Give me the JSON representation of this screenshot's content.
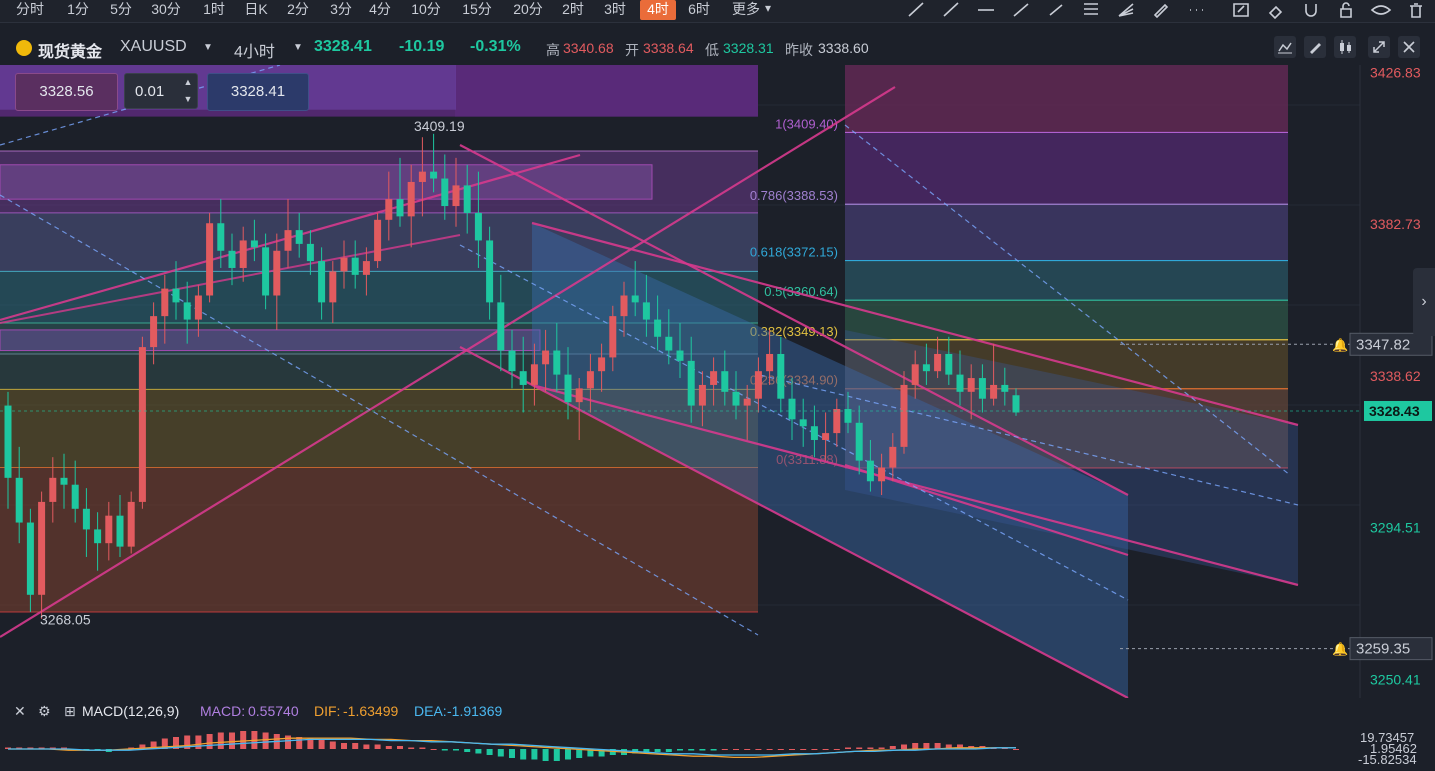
{
  "timeframes": {
    "items": [
      "分时",
      "1分",
      "5分",
      "30分",
      "1时",
      "日K",
      "2分",
      "3分",
      "4分",
      "10分",
      "15分",
      "20分",
      "2时",
      "3时",
      "4时",
      "6时",
      "更多"
    ],
    "active": "4时"
  },
  "toolbar_icons": [
    "trend-line-icon",
    "ray-line-icon",
    "horizontal-line-icon",
    "extended-line-icon",
    "segment-icon",
    "fibonacci-icon",
    "gann-fan-icon",
    "brush-icon",
    "more-icon",
    "edit-icon",
    "eraser-icon",
    "magnet-icon",
    "lock-icon",
    "visibility-icon",
    "trash-icon"
  ],
  "symbol": {
    "name": "现货黄金",
    "code": "XAUUSD",
    "interval": "4小时",
    "price": "3328.41",
    "change": "-10.19",
    "change_pct": "-0.31%",
    "high_label": "高",
    "high": "3340.68",
    "open_label": "开",
    "open": "3338.64",
    "low_label": "低",
    "low": "3328.31",
    "prev_label": "昨收",
    "prev": "3338.60"
  },
  "order_inputs": {
    "sell": "3328.56",
    "lot": "0.01",
    "buy": "3328.41"
  },
  "colors": {
    "up": "#e25b5f",
    "down": "#1ec8a0",
    "accent": "#ea6c3a",
    "line": "#d63a8d",
    "background": "#1c2029"
  },
  "chart_data": {
    "type": "candlestick",
    "symbol": "XAUUSD",
    "interval": "4小时",
    "price_axis": {
      "ticks": [
        3426.83,
        3382.73,
        3338.62,
        3294.51,
        3250.41
      ],
      "ylim": [
        3245.0,
        3429.0
      ],
      "current_price": "3328.43",
      "alert_levels": [
        "3347.82",
        "3259.35"
      ]
    },
    "annotations": {
      "swing_high": "3409.19",
      "swing_low": "3268.05"
    },
    "fibonacci": [
      {
        "ratio": "1",
        "price": "3409.40"
      },
      {
        "ratio": "0.786",
        "price": "3388.53"
      },
      {
        "ratio": "0.618",
        "price": "3372.15"
      },
      {
        "ratio": "0.5",
        "price": "3360.64"
      },
      {
        "ratio": "0.382",
        "price": "3349.13"
      },
      {
        "ratio": "0.236",
        "price": "3334.90"
      },
      {
        "ratio": "0",
        "price": "3311.88"
      }
    ],
    "horizontal_levels": [
      3369.0,
      3354.0,
      3334.7,
      3312.0,
      3270.0
    ],
    "candles": [
      [
        3330,
        3334,
        3300,
        3309
      ],
      [
        3309,
        3318,
        3290,
        3296
      ],
      [
        3296,
        3300,
        3270,
        3275
      ],
      [
        3275,
        3305,
        3268,
        3302
      ],
      [
        3302,
        3315,
        3296,
        3309
      ],
      [
        3309,
        3316,
        3300,
        3307
      ],
      [
        3307,
        3314,
        3296,
        3300
      ],
      [
        3300,
        3306,
        3286,
        3294
      ],
      [
        3294,
        3299,
        3282,
        3290
      ],
      [
        3290,
        3302,
        3285,
        3298
      ],
      [
        3298,
        3304,
        3286,
        3289
      ],
      [
        3289,
        3305,
        3287,
        3302
      ],
      [
        3302,
        3350,
        3300,
        3347
      ],
      [
        3347,
        3360,
        3342,
        3356
      ],
      [
        3356,
        3368,
        3348,
        3364
      ],
      [
        3364,
        3372,
        3355,
        3360
      ],
      [
        3360,
        3366,
        3348,
        3355
      ],
      [
        3355,
        3365,
        3350,
        3362
      ],
      [
        3362,
        3386,
        3360,
        3383
      ],
      [
        3383,
        3390,
        3370,
        3375
      ],
      [
        3375,
        3380,
        3365,
        3370
      ],
      [
        3370,
        3382,
        3366,
        3378
      ],
      [
        3378,
        3384,
        3372,
        3376
      ],
      [
        3376,
        3380,
        3358,
        3362
      ],
      [
        3362,
        3380,
        3352,
        3375
      ],
      [
        3375,
        3390,
        3370,
        3381
      ],
      [
        3381,
        3386,
        3373,
        3377
      ],
      [
        3377,
        3381,
        3368,
        3372
      ],
      [
        3372,
        3376,
        3355,
        3360
      ],
      [
        3360,
        3372,
        3354,
        3369
      ],
      [
        3369,
        3378,
        3364,
        3373
      ],
      [
        3373,
        3378,
        3364,
        3368
      ],
      [
        3368,
        3376,
        3362,
        3372
      ],
      [
        3372,
        3386,
        3370,
        3384
      ],
      [
        3384,
        3398,
        3378,
        3390
      ],
      [
        3390,
        3402,
        3382,
        3385
      ],
      [
        3385,
        3400,
        3376,
        3395
      ],
      [
        3395,
        3408,
        3385,
        3398
      ],
      [
        3398,
        3409,
        3392,
        3396
      ],
      [
        3396,
        3403,
        3384,
        3388
      ],
      [
        3388,
        3402,
        3382,
        3394
      ],
      [
        3394,
        3400,
        3380,
        3386
      ],
      [
        3386,
        3398,
        3370,
        3378
      ],
      [
        3378,
        3382,
        3355,
        3360
      ],
      [
        3360,
        3368,
        3340,
        3346
      ],
      [
        3346,
        3352,
        3335,
        3340
      ],
      [
        3340,
        3350,
        3328,
        3336
      ],
      [
        3336,
        3348,
        3330,
        3342
      ],
      [
        3342,
        3352,
        3334,
        3346
      ],
      [
        3346,
        3354,
        3334,
        3339
      ],
      [
        3339,
        3347,
        3326,
        3331
      ],
      [
        3331,
        3338,
        3320,
        3335
      ],
      [
        3335,
        3345,
        3328,
        3340
      ],
      [
        3340,
        3348,
        3334,
        3344
      ],
      [
        3344,
        3359,
        3340,
        3356
      ],
      [
        3356,
        3366,
        3350,
        3362
      ],
      [
        3362,
        3372,
        3356,
        3360
      ],
      [
        3360,
        3368,
        3350,
        3355
      ],
      [
        3355,
        3362,
        3346,
        3350
      ],
      [
        3350,
        3358,
        3342,
        3346
      ],
      [
        3346,
        3354,
        3338,
        3343
      ],
      [
        3343,
        3350,
        3325,
        3330
      ],
      [
        3330,
        3340,
        3324,
        3336
      ],
      [
        3336,
        3344,
        3330,
        3340
      ],
      [
        3340,
        3346,
        3330,
        3334
      ],
      [
        3334,
        3340,
        3326,
        3330
      ],
      [
        3330,
        3336,
        3320,
        3332
      ],
      [
        3332,
        3344,
        3328,
        3340
      ],
      [
        3340,
        3352,
        3336,
        3345
      ],
      [
        3345,
        3350,
        3328,
        3332
      ],
      [
        3332,
        3338,
        3320,
        3326
      ],
      [
        3326,
        3332,
        3318,
        3324
      ],
      [
        3324,
        3330,
        3315,
        3320
      ],
      [
        3320,
        3328,
        3314,
        3322
      ],
      [
        3322,
        3332,
        3318,
        3329
      ],
      [
        3329,
        3334,
        3322,
        3325
      ],
      [
        3325,
        3330,
        3310,
        3314
      ],
      [
        3314,
        3320,
        3305,
        3308
      ],
      [
        3308,
        3316,
        3304,
        3312
      ],
      [
        3312,
        3322,
        3308,
        3318
      ],
      [
        3318,
        3340,
        3316,
        3336
      ],
      [
        3336,
        3346,
        3332,
        3342
      ],
      [
        3342,
        3348,
        3336,
        3340
      ],
      [
        3340,
        3350,
        3338,
        3345
      ],
      [
        3345,
        3350,
        3336,
        3339
      ],
      [
        3339,
        3346,
        3330,
        3334
      ],
      [
        3334,
        3342,
        3326,
        3338
      ],
      [
        3338,
        3342,
        3328,
        3332
      ],
      [
        3332,
        3348,
        3330,
        3336
      ],
      [
        3336,
        3341,
        3330,
        3334
      ],
      [
        3333,
        3335,
        3327,
        3328
      ]
    ]
  },
  "macd": {
    "label": "MACD(12,26,9)",
    "macd_label": "MACD:",
    "macd": "0.55740",
    "dif_label": "DIF:",
    "dif": "-1.63499",
    "dea_label": "DEA:",
    "dea": "-1.91369",
    "axis": [
      "19.73457",
      "1.95462",
      "-15.82534"
    ],
    "bars": [
      1,
      1,
      1,
      1,
      1,
      1,
      0,
      -1,
      -1,
      -2,
      -1,
      1,
      3,
      5,
      7,
      8,
      9,
      9,
      10,
      11,
      11,
      12,
      12,
      11,
      10,
      9,
      8,
      7,
      6,
      5,
      4,
      4,
      3,
      3,
      2,
      2,
      1,
      1,
      0,
      -1,
      -1,
      -2,
      -3,
      -4,
      -5,
      -6,
      -7,
      -7,
      -8,
      -8,
      -7,
      -6,
      -5,
      -5,
      -4,
      -4,
      -3,
      -3,
      -2,
      -2,
      -1,
      -1,
      -1,
      -1,
      0,
      0,
      0,
      0,
      0,
      0,
      0,
      0,
      0,
      0,
      0,
      1,
      1,
      1,
      1,
      2,
      3,
      4,
      4,
      4,
      3,
      3,
      2,
      2,
      1,
      1,
      0
    ],
    "dif_line": [
      0,
      0,
      0,
      -1,
      -1,
      -1,
      0,
      1,
      2,
      3,
      5,
      6,
      7,
      8,
      9,
      9,
      9,
      9,
      8,
      8,
      7,
      7,
      6,
      5,
      4,
      3,
      2,
      1,
      0,
      -1,
      -2,
      -3,
      -4,
      -5,
      -6,
      -6,
      -7,
      -7,
      -6,
      -5,
      -4,
      -3,
      -2,
      -1,
      -1,
      0,
      0,
      1,
      1,
      1,
      1
    ],
    "dea_line": [
      0,
      0,
      0,
      0,
      -1,
      -1,
      -1,
      0,
      1,
      2,
      3,
      4,
      5,
      6,
      7,
      8,
      8,
      8,
      8,
      7,
      7,
      6,
      6,
      5,
      4,
      4,
      3,
      2,
      1,
      0,
      -1,
      -2,
      -3,
      -4,
      -4,
      -5,
      -5,
      -5,
      -5,
      -4,
      -4,
      -3,
      -2,
      -2,
      -1,
      -1,
      0,
      0,
      0,
      1,
      1
    ]
  }
}
